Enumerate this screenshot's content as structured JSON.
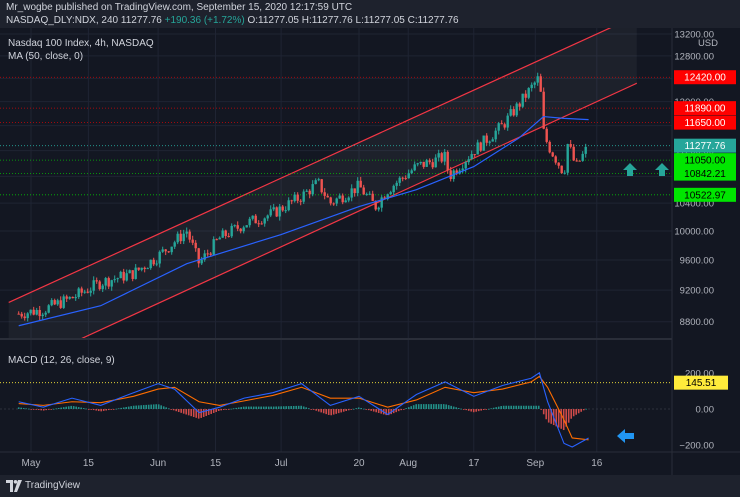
{
  "header": {
    "publisher_line": "Mr_wogbe published on TradingView.com, September 15, 2020 12:17:59 UTC",
    "symbol": "NASDAQ_DLY:NDX, 240",
    "price": "11277.76",
    "change": "+190.36 (+1.72%)",
    "open": "O:11277.05",
    "high": "H:11277.76",
    "low": "L:11277.05",
    "close": "C:11277.76"
  },
  "footer": {
    "brand": "TradingView"
  },
  "colors": {
    "background": "#131722",
    "channel": "#f23645",
    "ma": "#2962ff",
    "up": "#26a69a",
    "down": "#ef5350",
    "green_label": "#00e600",
    "red_label": "#ff0000",
    "macd_line": "#2962ff",
    "signal_line": "#ff6d00"
  },
  "chart_data": [
    {
      "type": "line",
      "title": "Nasdaq 100 Index, 4h, NASDAQ",
      "indicator_label": "MA (50, close, 0)",
      "currency": "USD",
      "y_scale": "log",
      "ylim": [
        8600,
        13200
      ],
      "y_ticks": [
        8800,
        9200,
        9600,
        10000,
        10400,
        10800,
        11200,
        11600,
        12000,
        12400,
        12800,
        13200
      ],
      "x_labels": [
        "May",
        "15",
        "Jun",
        "15",
        "Jul",
        "20",
        "Aug",
        "17",
        "Sep",
        "16"
      ],
      "grid": true,
      "price_series": {
        "name": "NDX",
        "x": [
          "Apr 28",
          "May 4",
          "May 11",
          "May 18",
          "May 26",
          "Jun 1",
          "Jun 8",
          "Jun 11",
          "Jun 16",
          "Jun 22",
          "Jun 29",
          "Jul 6",
          "Jul 10",
          "Jul 13",
          "Jul 20",
          "Jul 24",
          "Jul 27",
          "Aug 3",
          "Aug 10",
          "Aug 11",
          "Aug 17",
          "Aug 24",
          "Aug 28",
          "Sep 2",
          "Sep 3",
          "Sep 4",
          "Sep 8",
          "Sep 9",
          "Sep 10",
          "Sep 11",
          "Sep 14"
        ],
        "close": [
          8900,
          8950,
          9100,
          9300,
          9420,
          9650,
          10000,
          9550,
          9900,
          10100,
          10250,
          10500,
          10700,
          10400,
          10650,
          10350,
          10600,
          10950,
          11100,
          10800,
          11200,
          11600,
          11950,
          12420,
          11500,
          11300,
          10850,
          11350,
          11100,
          10950,
          11277.76
        ]
      },
      "ma_series": {
        "name": "MA (50, close, 0)",
        "x": [
          "Apr 28",
          "May 18",
          "Jun 8",
          "Jul 1",
          "Jul 20",
          "Aug 3",
          "Aug 17",
          "Aug 28",
          "Sep 3",
          "Sep 8",
          "Sep 14"
        ],
        "values": [
          8750,
          9000,
          9550,
          9950,
          10350,
          10600,
          10950,
          11400,
          11750,
          11720,
          11700
        ]
      },
      "channel": {
        "upper": {
          "x": [
            "Apr 28",
            "Sep 16"
          ],
          "values": [
            9100,
            13200
          ]
        },
        "lower": {
          "x": [
            "Apr 28",
            "Sep 16"
          ],
          "values": [
            8250,
            12000
          ]
        }
      },
      "levels": [
        {
          "value": 12420.0,
          "label": "12420.00",
          "color": "#ff0000"
        },
        {
          "value": 11890.0,
          "label": "11890.00",
          "color": "#ff0000"
        },
        {
          "value": 11650.0,
          "label": "11650.00",
          "color": "#ff0000"
        },
        {
          "value": 11050.0,
          "label": "11050.00",
          "color": "#00e600"
        },
        {
          "value": 10842.21,
          "label": "10842.21",
          "color": "#00e600"
        },
        {
          "value": 10522.97,
          "label": "10522.97",
          "color": "#00e600"
        }
      ],
      "last_price": {
        "value": 11277.76,
        "label": "11277.76",
        "color": "#26a69a"
      },
      "annotations": [
        "up-arrow",
        "up-arrow"
      ]
    },
    {
      "type": "line",
      "title": "MACD (12, 26, close, 9)",
      "ylim": [
        -240,
        240
      ],
      "y_ticks": [
        -200,
        0,
        200
      ],
      "y_tick_labels": [
        "−200.00",
        "0.00",
        "200.00"
      ],
      "level": {
        "value": 145.51,
        "label": "145.51",
        "color": "#ffeb3b"
      },
      "x": [
        "Apr 28",
        "May 4",
        "May 11",
        "May 18",
        "May 26",
        "Jun 1",
        "Jun 5",
        "Jun 11",
        "Jun 16",
        "Jun 22",
        "Jun 29",
        "Jul 6",
        "Jul 13",
        "Jul 20",
        "Jul 27",
        "Aug 3",
        "Aug 10",
        "Aug 17",
        "Aug 24",
        "Aug 31",
        "Sep 2",
        "Sep 4",
        "Sep 8",
        "Sep 10",
        "Sep 14"
      ],
      "series": [
        {
          "name": "MACD",
          "values": [
            40,
            10,
            60,
            20,
            90,
            140,
            110,
            -20,
            10,
            60,
            90,
            140,
            20,
            70,
            -30,
            80,
            150,
            70,
            130,
            170,
            200,
            40,
            -190,
            -210,
            -160
          ]
        },
        {
          "name": "Signal",
          "values": [
            30,
            20,
            40,
            35,
            70,
            110,
            120,
            40,
            20,
            45,
            75,
            120,
            60,
            60,
            10,
            50,
            120,
            90,
            110,
            150,
            180,
            120,
            -60,
            -160,
            -170
          ]
        }
      ],
      "annotations": [
        "left-arrow"
      ]
    }
  ]
}
